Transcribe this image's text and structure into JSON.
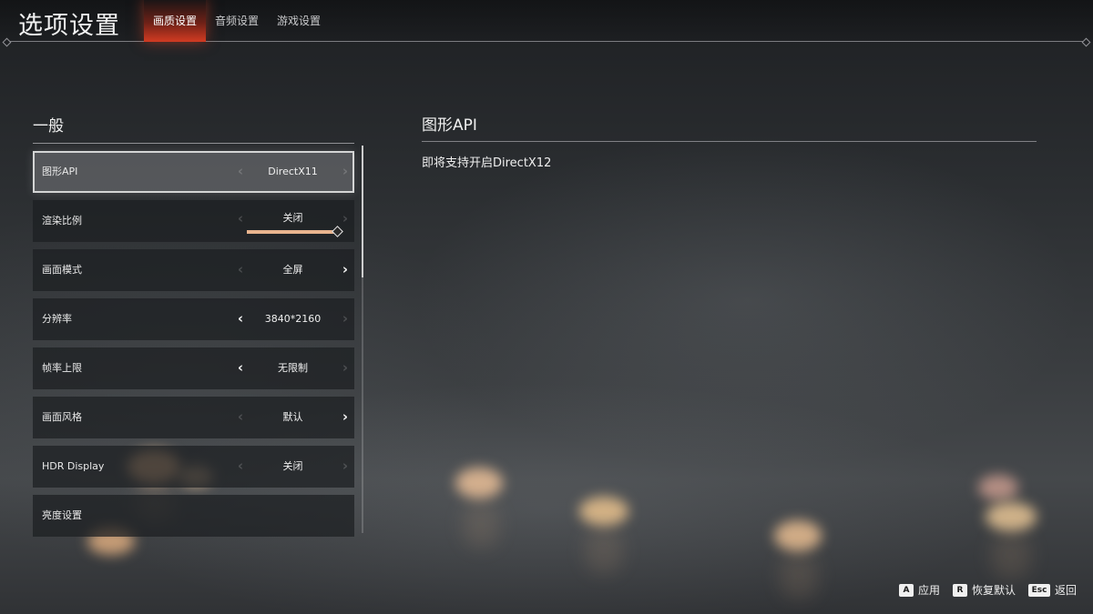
{
  "header": {
    "title": "选项设置",
    "tabs": [
      {
        "label": "画质设置",
        "active": true
      },
      {
        "label": "音频设置",
        "active": false
      },
      {
        "label": "游戏设置",
        "active": false
      }
    ]
  },
  "general": {
    "section_title": "一般",
    "items": [
      {
        "label": "图形API",
        "value": "DirectX11",
        "left_enabled": false,
        "right_enabled": false,
        "selected": true
      },
      {
        "label": "渲染比例",
        "value": "关闭",
        "left_enabled": false,
        "right_enabled": false,
        "slider_level": 1.0
      },
      {
        "label": "画面模式",
        "value": "全屏",
        "left_enabled": false,
        "right_enabled": true
      },
      {
        "label": "分辨率",
        "value": "3840*2160",
        "left_enabled": true,
        "right_enabled": false
      },
      {
        "label": "帧率上限",
        "value": "无限制",
        "left_enabled": true,
        "right_enabled": false
      },
      {
        "label": "画面风格",
        "value": "默认",
        "left_enabled": false,
        "right_enabled": true
      },
      {
        "label": "HDR Display",
        "value": "关闭",
        "left_enabled": false,
        "right_enabled": false
      },
      {
        "label": "亮度设置"
      }
    ]
  },
  "detail": {
    "title": "图形API",
    "description": "即将支持开启DirectX12"
  },
  "hints": [
    {
      "key": "A",
      "label": "应用"
    },
    {
      "key": "R",
      "label": "恢复默认"
    },
    {
      "key": "Esc",
      "label": "返回"
    }
  ],
  "colors": {
    "active_tab": "#d23b22",
    "slider_fill": "#e9b48e"
  },
  "icons": {
    "left_arrow": "chevron-left-icon",
    "right_arrow": "chevron-right-icon"
  }
}
